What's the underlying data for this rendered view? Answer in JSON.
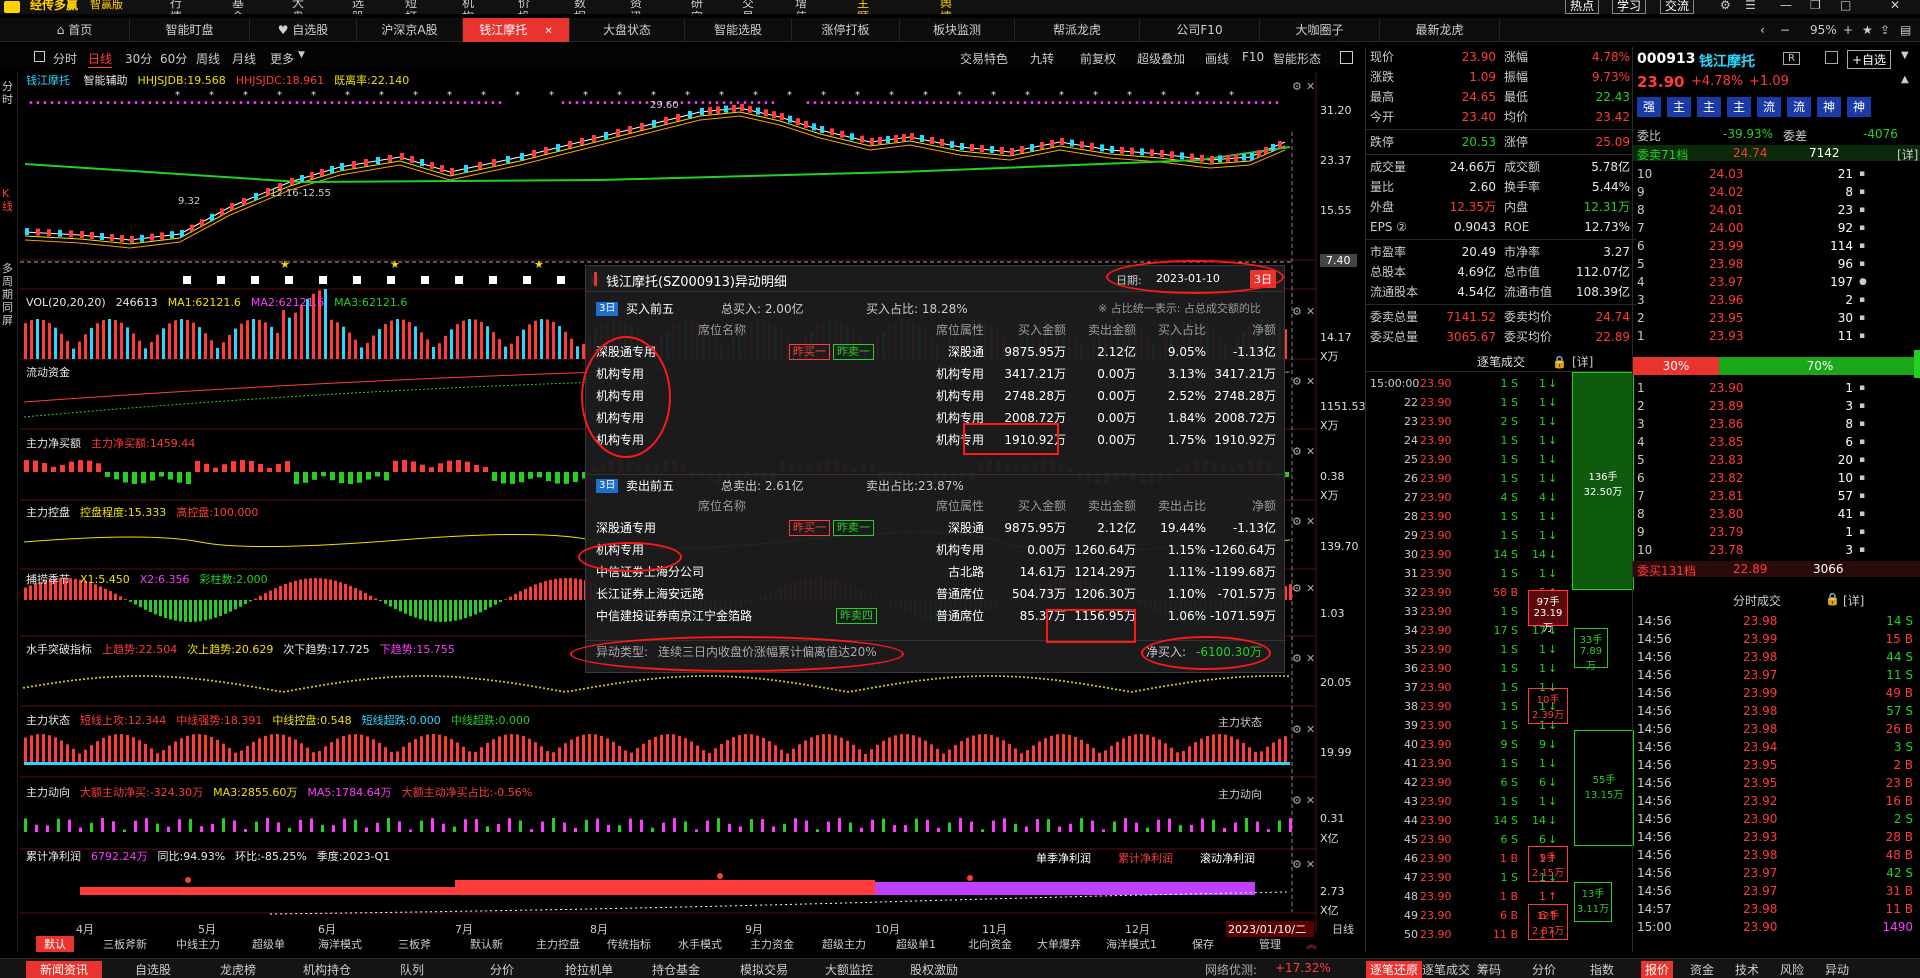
{
  "menubar": {
    "brand": "经传多赢",
    "edition": "智赢版",
    "items": [
      "行情",
      "基金",
      "大盘",
      "选股",
      "短打",
      "机构",
      "价投",
      "数据",
      "资讯",
      "研究院",
      "交易",
      "增值",
      "主题猎手",
      "舆情猎手"
    ],
    "right": [
      "热点",
      "学习",
      "交流"
    ]
  },
  "tabs": [
    "首页",
    "智能盯盘",
    "自选股",
    "沪深京A股",
    "钱江摩托",
    "大盘状态",
    "智能选股",
    "涨停打板",
    "板块监测",
    "帮派龙虎",
    "公司F10",
    "大咖圈子",
    "最新龙虎"
  ],
  "zoom": "95%",
  "toolbar": {
    "periods": [
      "分时",
      "日线",
      "30分",
      "60分",
      "周线",
      "月线",
      "更多"
    ],
    "right": [
      "交易特色",
      "九转",
      "前复权",
      "超级叠加",
      "画线",
      "F10",
      "智能形态"
    ]
  },
  "leftnav": [
    "分时",
    "K线",
    "多周期同屏"
  ],
  "kline": {
    "name": "钱江摩托",
    "items": [
      {
        "label": "智能辅助",
        "color": "#e8e8e8"
      },
      {
        "label": "HHJSJDB:19.568",
        "color": "#f0e000"
      },
      {
        "label": "HHJSJDC:18.961",
        "color": "#ff3b3b"
      },
      {
        "label": "既离率:22.140",
        "color": "#f0e000"
      }
    ],
    "axis": [
      "31.20",
      "23.37",
      "15.55",
      "7.40"
    ],
    "annotations": [
      "29.60",
      "9.32",
      "12.16-12.55"
    ]
  },
  "vol": {
    "items": [
      {
        "label": "VOL(20,20,20)",
        "color": "#e8e8e8"
      },
      {
        "label": "246613",
        "color": "#e8e8e8"
      },
      {
        "label": "MA1:62121.6",
        "color": "#f0e000"
      },
      {
        "label": "MA2:62121.6",
        "color": "#ff3bff"
      },
      {
        "label": "MA3:62121.6",
        "color": "#25d025"
      }
    ],
    "axis": [
      "14.17",
      "X万"
    ]
  },
  "panes": [
    {
      "items": [
        {
          "label": "流动资金",
          "color": "#e8e8e8"
        }
      ],
      "axis": [
        "1151.53",
        "X万"
      ]
    },
    {
      "items": [
        {
          "label": "主力净买额",
          "color": "#e8e8e8"
        },
        {
          "label": "主力净买额:1459.44",
          "color": "#ff3b3b"
        }
      ],
      "axis": [
        "0.38",
        "X万"
      ]
    },
    {
      "items": [
        {
          "label": "主力控盘",
          "color": "#e8e8e8"
        },
        {
          "label": "控盘程度:15.333",
          "color": "#f0e000"
        },
        {
          "label": "高控盘:100.000",
          "color": "#ff3b3b"
        }
      ],
      "axis": [
        "139.70"
      ]
    },
    {
      "items": [
        {
          "label": "捕捞季节",
          "color": "#e8e8e8"
        },
        {
          "label": "X1:5.450",
          "color": "#f0e000"
        },
        {
          "label": "X2:6.356",
          "color": "#ff3bff"
        },
        {
          "label": "彩柱数:2.000",
          "color": "#25d025"
        }
      ],
      "axis": [
        "1.03"
      ]
    },
    {
      "items": [
        {
          "label": "水手突破指标",
          "color": "#e8e8e8"
        },
        {
          "label": "上趋势:22.504",
          "color": "#ff3b3b"
        },
        {
          "label": "次上趋势:20.629",
          "color": "#f0e000"
        },
        {
          "label": "次下趋势:17.725",
          "color": "#e8e8e8"
        },
        {
          "label": "下趋势:15.755",
          "color": "#ff3bff"
        }
      ],
      "axis": [
        "20.05"
      ]
    },
    {
      "items": [
        {
          "label": "主力状态",
          "color": "#e8e8e8"
        },
        {
          "label": "短线上攻:12.344",
          "color": "#ff3b3b"
        },
        {
          "label": "中线强势:18.391",
          "color": "#ff3b3b"
        },
        {
          "label": "中线控盘:0.548",
          "color": "#f0e000"
        },
        {
          "label": "短线超跌:0.000",
          "color": "#2ad8ff"
        },
        {
          "label": "中线超跌:0.000",
          "color": "#25d025"
        }
      ],
      "axis": [
        "19.99"
      ],
      "righttag": "主力状态"
    },
    {
      "items": [
        {
          "label": "主力动向",
          "color": "#e8e8e8"
        },
        {
          "label": "大额主动净买:-324.30万",
          "color": "#ff3b3b"
        },
        {
          "label": "MA3:2855.60万",
          "color": "#f0e000"
        },
        {
          "label": "MA5:1784.64万",
          "color": "#ff3bff"
        },
        {
          "label": "大额主动净买占比:-0.56%",
          "color": "#ff3b3b"
        }
      ],
      "axis": [
        "0.31",
        "X亿"
      ],
      "righttag": "主力动向"
    },
    {
      "items": [
        {
          "label": "累计净利润",
          "color": "#e8e8e8"
        },
        {
          "label": "6792.24万",
          "color": "#ff3bff"
        },
        {
          "label": "同比:94.93%",
          "color": "#e8e8e8"
        },
        {
          "label": "环比:-85.25%",
          "color": "#e8e8e8"
        },
        {
          "label": "季度:2023-Q1",
          "color": "#e8e8e8"
        }
      ],
      "axis": [
        "2.73",
        "X亿"
      ],
      "rightbtns": [
        "单季净利润",
        "累计净利润",
        "滚动净利润"
      ]
    }
  ],
  "months": [
    "4月",
    "5月",
    "6月",
    "7月",
    "8月",
    "9月",
    "10月",
    "11月",
    "12月"
  ],
  "date_tag": "2023/01/10/二",
  "date_mode": "日线",
  "popup": {
    "title": "钱江摩托(SZ000913)异动明细",
    "date_label": "日期:",
    "date": "2023-01-10",
    "period": "3日",
    "buy": {
      "tag": "3日",
      "label": "买入前五",
      "total": "总买入: 2.00亿",
      "ratio": "买入占比: 18.28%",
      "note": "※ 占比统一表示: 占总成交额的比",
      "cols": [
        "席位名称",
        "席位属性",
        "买入金额",
        "卖出金额",
        "买入占比",
        "净额"
      ],
      "rows": [
        {
          "name": "深股通专用",
          "badges": [
            "昨买一",
            "昨卖一"
          ],
          "attr": "深股通",
          "buy": "9875.95万",
          "sell": "2.12亿",
          "ratio": "9.05%",
          "net": "-1.13亿"
        },
        {
          "name": "机构专用",
          "badges": [],
          "attr": "机构专用",
          "buy": "3417.21万",
          "sell": "0.00万",
          "ratio": "3.13%",
          "net": "3417.21万"
        },
        {
          "name": "机构专用",
          "badges": [],
          "attr": "机构专用",
          "buy": "2748.28万",
          "sell": "0.00万",
          "ratio": "2.52%",
          "net": "2748.28万"
        },
        {
          "name": "机构专用",
          "badges": [],
          "attr": "机构专用",
          "buy": "2008.72万",
          "sell": "0.00万",
          "ratio": "1.84%",
          "net": "2008.72万"
        },
        {
          "name": "机构专用",
          "badges": [],
          "attr": "机构专用",
          "buy": "1910.92万",
          "sell": "0.00万",
          "ratio": "1.75%",
          "net": "1910.92万"
        }
      ]
    },
    "sell": {
      "tag": "3日",
      "label": "卖出前五",
      "total": "总卖出: 2.61亿",
      "ratio": "卖出占比:23.87%",
      "cols": [
        "席位名称",
        "席位属性",
        "买入金额",
        "卖出金额",
        "卖出占比",
        "净额"
      ],
      "rows": [
        {
          "name": "深股通专用",
          "badges": [
            "昨买一",
            "昨卖一"
          ],
          "attr": "深股通",
          "buy": "9875.95万",
          "sell": "2.12亿",
          "ratio": "19.44%",
          "net": "-1.13亿"
        },
        {
          "name": "机构专用",
          "badges": [],
          "attr": "机构专用",
          "buy": "0.00万",
          "sell": "1260.64万",
          "ratio": "1.15%",
          "net": "-1260.64万"
        },
        {
          "name": "中信证券上海分公司",
          "badges": [],
          "attr": "古北路",
          "buy": "14.61万",
          "sell": "1214.29万",
          "ratio": "1.11%",
          "net": "-1199.68万"
        },
        {
          "name": "长江证券上海安远路",
          "badges": [],
          "attr": "普通席位",
          "buy": "504.73万",
          "sell": "1206.30万",
          "ratio": "1.10%",
          "net": "-701.57万"
        },
        {
          "name": "中信建投证券南京江宁金箔路",
          "badges": [
            "昨卖四"
          ],
          "attr": "普通席位",
          "buy": "85.37万",
          "sell": "1156.95万",
          "ratio": "1.06%",
          "net": "-1071.59万"
        }
      ]
    },
    "type_label": "异动类型:",
    "type": "连续三日内收盘价涨幅累计偏离值达20%",
    "net_label": "净买入:",
    "net": "-6100.30万"
  },
  "quote": {
    "rows": [
      [
        "现价",
        "23.90",
        "涨幅",
        "4.78%"
      ],
      [
        "涨跌",
        "1.09",
        "振幅",
        "9.73%"
      ],
      [
        "最高",
        "24.65",
        "最低",
        "22.43"
      ],
      [
        "今开",
        "23.40",
        "均价",
        "23.42"
      ],
      [
        "跌停",
        "20.53",
        "涨停",
        "25.09"
      ],
      [
        "成交量",
        "24.66万",
        "成交额",
        "5.78亿"
      ],
      [
        "量比",
        "2.60",
        "换手率",
        "5.44%"
      ],
      [
        "外盘",
        "12.35万",
        "内盘",
        "12.31万"
      ],
      [
        "EPS ②",
        "0.9043",
        "ROE",
        "12.73%"
      ],
      [
        "市盈率",
        "20.49",
        "市净率",
        "3.27"
      ],
      [
        "总股本",
        "4.69亿",
        "总市值",
        "112.07亿"
      ],
      [
        "流通股本",
        "4.54亿",
        "流通市值",
        "108.39亿"
      ],
      [
        "委卖总量",
        "7141.52",
        "委卖均价",
        "24.74"
      ],
      [
        "委买总量",
        "3065.67",
        "委买均价",
        "22.89"
      ]
    ]
  },
  "ticks": {
    "title": "逐笔成交",
    "detail": "[详]",
    "rows": [
      [
        "15:00:00",
        "23.90",
        "1 S",
        "1"
      ],
      [
        "22",
        "23.90",
        "1 S",
        "1"
      ],
      [
        "23",
        "23.90",
        "2 S",
        "1"
      ],
      [
        "24",
        "23.90",
        "1 S",
        "1"
      ],
      [
        "25",
        "23.90",
        "1 S",
        "1"
      ],
      [
        "26",
        "23.90",
        "1 S",
        "1"
      ],
      [
        "27",
        "23.90",
        "4 S",
        "4"
      ],
      [
        "28",
        "23.90",
        "1 S",
        "1"
      ],
      [
        "29",
        "23.90",
        "1 S",
        "1"
      ],
      [
        "30",
        "23.90",
        "14 S",
        "14"
      ],
      [
        "31",
        "23.90",
        "1 S",
        "1"
      ],
      [
        "32",
        "23.90",
        "58 B",
        "5"
      ],
      [
        "33",
        "23.90",
        "1 S",
        "1"
      ],
      [
        "34",
        "23.90",
        "17 S",
        "17"
      ],
      [
        "35",
        "23.90",
        "1 S",
        "1"
      ],
      [
        "36",
        "23.90",
        "1 S",
        "1"
      ],
      [
        "37",
        "23.90",
        "1 S",
        "1"
      ],
      [
        "38",
        "23.90",
        "1 S",
        "1"
      ],
      [
        "39",
        "23.90",
        "1 S",
        "1"
      ],
      [
        "40",
        "23.90",
        "9 S",
        "9"
      ],
      [
        "41",
        "23.90",
        "1 S",
        "1"
      ],
      [
        "42",
        "23.90",
        "6 S",
        "6"
      ],
      [
        "43",
        "23.90",
        "1 S",
        "1"
      ],
      [
        "44",
        "23.90",
        "14 S",
        "14"
      ],
      [
        "45",
        "23.90",
        "6 S",
        "6"
      ],
      [
        "46",
        "23.90",
        "1 B",
        "1"
      ],
      [
        "47",
        "23.90",
        "1 S",
        "1"
      ],
      [
        "48",
        "23.90",
        "1 B",
        "1"
      ],
      [
        "49",
        "23.90",
        "6 B",
        "6"
      ],
      [
        "50",
        "23.90",
        "11 B",
        "1"
      ]
    ],
    "blocks": [
      {
        "label": "136手",
        "sub": "32.50万"
      },
      {
        "label": "97手",
        "sub": "23.19万"
      },
      {
        "label": "33手",
        "sub": "7.89万"
      },
      {
        "label": "10手",
        "sub": "2.39万"
      },
      {
        "label": "55手",
        "sub": "13.15万"
      },
      {
        "label": "9手",
        "sub": "2.15万"
      },
      {
        "label": "12手",
        "sub": "2.87万"
      },
      {
        "label": "13手",
        "sub": "3.11万"
      }
    ]
  },
  "book": {
    "code": "000913",
    "name": "钱江摩托",
    "r": "R",
    "add": "+自选",
    "price": "23.90",
    "pct": "+4.78%",
    "chg": "+1.09",
    "strength": [
      "强",
      "主",
      "主",
      "主",
      "流",
      "流",
      "神",
      "神"
    ],
    "weibi_label": "委比",
    "weibi": "-39.93%",
    "weicha_label": "委差",
    "weicha": "-4076",
    "sell_label": "委卖71档",
    "sell_price": "24.74",
    "sell_vol": "7142",
    "detail": "[详]",
    "asks": [
      [
        "10",
        "24.03",
        "21"
      ],
      [
        "9",
        "24.02",
        "8"
      ],
      [
        "8",
        "24.01",
        "23"
      ],
      [
        "7",
        "24.00",
        "92"
      ],
      [
        "6",
        "23.99",
        "114"
      ],
      [
        "5",
        "23.98",
        "96"
      ],
      [
        "4",
        "23.97",
        "197"
      ],
      [
        "3",
        "23.96",
        "2"
      ],
      [
        "2",
        "23.95",
        "30"
      ],
      [
        "1",
        "23.93",
        "11"
      ]
    ],
    "ratio_sell": "30%",
    "ratio_buy": "70%",
    "bids": [
      [
        "1",
        "23.90",
        "1"
      ],
      [
        "2",
        "23.89",
        "3"
      ],
      [
        "3",
        "23.86",
        "8"
      ],
      [
        "4",
        "23.85",
        "6"
      ],
      [
        "5",
        "23.83",
        "20"
      ],
      [
        "6",
        "23.82",
        "10"
      ],
      [
        "7",
        "23.81",
        "57"
      ],
      [
        "8",
        "23.80",
        "41"
      ],
      [
        "9",
        "23.79",
        "1"
      ],
      [
        "10",
        "23.78",
        "3"
      ]
    ],
    "buy_label": "委买131档",
    "buy_price": "22.89",
    "buy_vol": "3066",
    "min_title": "分时成交",
    "min_detail": "[详]",
    "minute": [
      [
        "14:56",
        "23.98",
        "14 S"
      ],
      [
        "14:56",
        "23.99",
        "15 B"
      ],
      [
        "14:56",
        "23.98",
        "44 S"
      ],
      [
        "14:56",
        "23.97",
        "11 S"
      ],
      [
        "14:56",
        "23.99",
        "49 B"
      ],
      [
        "14:56",
        "23.98",
        "57 S"
      ],
      [
        "14:56",
        "23.98",
        "26 B"
      ],
      [
        "14:56",
        "23.94",
        "3 S"
      ],
      [
        "14:56",
        "23.95",
        "2 B"
      ],
      [
        "14:56",
        "23.95",
        "23 B"
      ],
      [
        "14:56",
        "23.92",
        "16 B"
      ],
      [
        "14:56",
        "23.90",
        "2 S"
      ],
      [
        "14:56",
        "23.93",
        "28 B"
      ],
      [
        "14:56",
        "23.98",
        "48 B"
      ],
      [
        "14:56",
        "23.97",
        "42 S"
      ],
      [
        "14:56",
        "23.97",
        "31 B"
      ],
      [
        "14:57",
        "23.98",
        "11 B"
      ],
      [
        "15:00",
        "23.90",
        "1490"
      ]
    ]
  },
  "bottomtabs": [
    "默认",
    "三板斧新",
    "中线主力",
    "超级单",
    "海洋模式",
    "三板斧",
    "默认新",
    "主力控盘",
    "传统指标",
    "水手模式",
    "主力资金",
    "超级主力",
    "超级单1",
    "北向资金",
    "大单爆弃",
    "海洋模式1",
    "保存",
    "管理"
  ],
  "status": {
    "items": [
      "新闻资讯",
      "自选股",
      "龙虎榜",
      "机构持仓",
      "队列",
      "分价",
      "抢拉机单",
      "持仓基金",
      "模拟交易",
      "大额监控",
      "股权激励"
    ],
    "net_label": "网络优测:",
    "net_value": "+17.32%",
    "right": [
      "逐笔还原",
      "逐笔成交",
      "筹码",
      "分价",
      "指数",
      "报价",
      "资金",
      "技术",
      "风险",
      "异动"
    ]
  },
  "colors": {
    "up": "#ff3b3b",
    "down": "#25d025",
    "accent": "#e8332f"
  }
}
